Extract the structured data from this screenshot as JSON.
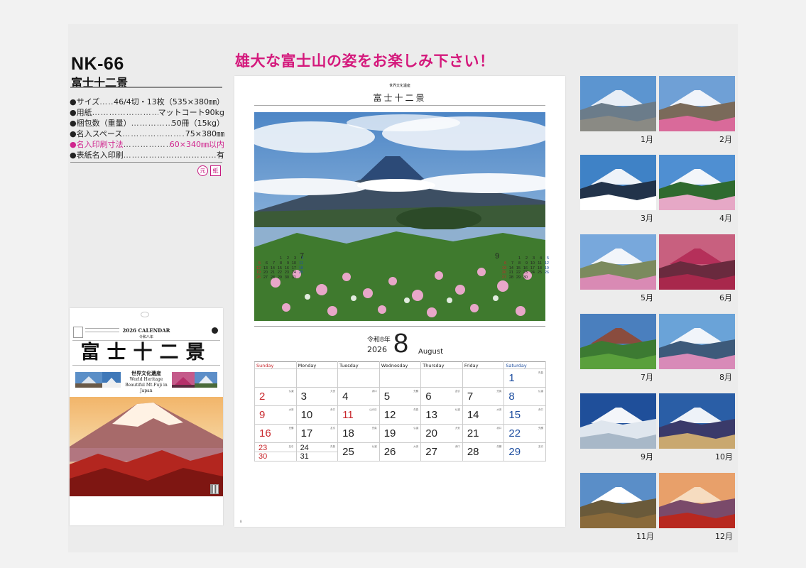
{
  "product": {
    "code": "NK-66",
    "name": "富士十二景"
  },
  "specs": [
    {
      "key": "●サイズ",
      "dots": "……",
      "value": "46/4切・13枚（535×380㎜）",
      "highlight": false
    },
    {
      "key": "●用紙",
      "dots": "……………………………",
      "value": "マットコート90kg",
      "highlight": false
    },
    {
      "key": "●梱包数（重量）",
      "dots": "……………………………",
      "value": "50冊（15kg）",
      "highlight": false
    },
    {
      "key": "●名入スペース",
      "dots": "……………………………",
      "value": "75×380㎜",
      "highlight": false
    },
    {
      "key": "●名入印刷寸法",
      "dots": "……………………………",
      "value": "60×340㎜以内",
      "highlight": true
    },
    {
      "key": "●表紙名入印刷",
      "dots": "……………………………………………",
      "value": "有",
      "highlight": false
    }
  ],
  "badges": [
    "元",
    "紙"
  ],
  "headline": "雄大な富士山の姿をお楽しみ下さい！",
  "cover": {
    "calendar_label": "2026 CALENDAR",
    "era_label": "令和八年",
    "title": "富士十二景",
    "sub1": "世界文化遺産",
    "sub2": "World Heritage",
    "sub3": "Beautiful Mt.Fuji in Japan"
  },
  "main": {
    "series_small": "世界文化遺産",
    "series_title": "富士十二景",
    "era": "令和8年",
    "year": "2026",
    "month_number": "8",
    "month_name": "August",
    "weekdays": [
      "Sunday",
      "Monday",
      "Tuesday",
      "Wednesday",
      "Thursday",
      "Friday",
      "Saturday"
    ],
    "weeks": [
      [
        {
          "t": ""
        },
        {
          "t": ""
        },
        {
          "t": ""
        },
        {
          "t": ""
        },
        {
          "t": ""
        },
        {
          "t": ""
        },
        {
          "t": "1",
          "n": "先負"
        }
      ],
      [
        {
          "t": "2",
          "n": "仏滅"
        },
        {
          "t": "3",
          "n": "大安"
        },
        {
          "t": "4",
          "n": "赤口"
        },
        {
          "t": "5",
          "n": "先勝"
        },
        {
          "t": "6",
          "n": "友引"
        },
        {
          "t": "7",
          "n": "先負"
        },
        {
          "t": "8",
          "n": "仏滅"
        }
      ],
      [
        {
          "t": "9",
          "n": "大安"
        },
        {
          "t": "10",
          "n": "赤口"
        },
        {
          "t": "11",
          "n": "山の日"
        },
        {
          "t": "12",
          "n": "先負"
        },
        {
          "t": "13",
          "n": "仏滅"
        },
        {
          "t": "14",
          "n": "大安"
        },
        {
          "t": "15",
          "n": "赤口"
        }
      ],
      [
        {
          "t": "16",
          "n": "先勝"
        },
        {
          "t": "17",
          "n": "友引"
        },
        {
          "t": "18",
          "n": "先負"
        },
        {
          "t": "19",
          "n": "仏滅"
        },
        {
          "t": "20",
          "n": "大安"
        },
        {
          "t": "21",
          "n": "赤口"
        },
        {
          "t": "22",
          "n": "先勝"
        }
      ],
      [
        {
          "t": "23",
          "t2": "30",
          "n": "友引"
        },
        {
          "t": "24",
          "t2": "31",
          "n": "先負"
        },
        {
          "t": "25",
          "n": "仏滅"
        },
        {
          "t": "26",
          "n": "大安"
        },
        {
          "t": "27",
          "n": "赤口"
        },
        {
          "t": "28",
          "n": "先勝"
        },
        {
          "t": "29",
          "n": "友引"
        }
      ]
    ],
    "page_number": "8"
  },
  "mini_prev": {
    "month": "7",
    "rows": [
      [
        "",
        "",
        "",
        "1",
        "2",
        "3",
        "4"
      ],
      [
        "5",
        "6",
        "7",
        "8",
        "9",
        "10",
        "11"
      ],
      [
        "12",
        "13",
        "14",
        "15",
        "16",
        "17",
        "18"
      ],
      [
        "19",
        "20",
        "21",
        "22",
        "23",
        "24",
        "25"
      ],
      [
        "26",
        "27",
        "28",
        "29",
        "30",
        "31",
        ""
      ]
    ]
  },
  "mini_next": {
    "month": "9",
    "rows": [
      [
        "",
        "",
        "1",
        "2",
        "3",
        "4",
        "5"
      ],
      [
        "6",
        "7",
        "8",
        "9",
        "10",
        "11",
        "12"
      ],
      [
        "13",
        "14",
        "15",
        "16",
        "17",
        "18",
        "19"
      ],
      [
        "20",
        "21",
        "22",
        "23",
        "24",
        "25",
        "26"
      ],
      [
        "27",
        "28",
        "29",
        "30",
        "",
        "",
        ""
      ]
    ]
  },
  "thumbnails": [
    {
      "label": "1月"
    },
    {
      "label": "2月"
    },
    {
      "label": "3月"
    },
    {
      "label": "4月"
    },
    {
      "label": "5月"
    },
    {
      "label": "6月"
    },
    {
      "label": "7月"
    },
    {
      "label": "8月"
    },
    {
      "label": "9月"
    },
    {
      "label": "10月"
    },
    {
      "label": "11月"
    },
    {
      "label": "12月"
    }
  ],
  "colors": {
    "accent_pink": "#d4197c",
    "sunday_red": "#c8262b",
    "saturday_blue": "#1f4fa0"
  }
}
